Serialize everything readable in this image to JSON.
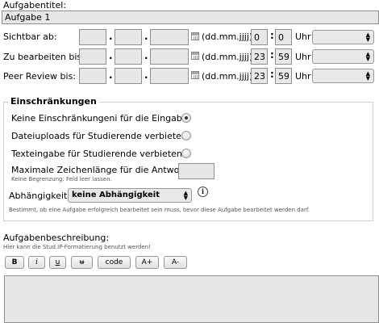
{
  "title": {
    "label": "Aufgabentitel:",
    "value": "Aufgabe 1"
  },
  "date_rows": [
    {
      "label": "Sichtbar ab:",
      "day": "",
      "month": "",
      "year": "",
      "format": "(dd.mm.jjjj)",
      "hour": "0",
      "minute": "0",
      "uhr": "Uhr",
      "select": ""
    },
    {
      "label": "Zu bearbeiten bis:",
      "day": "",
      "month": "",
      "year": "",
      "format": "(dd.mm.jjjj)",
      "hour": "23",
      "minute": "59",
      "uhr": "Uhr",
      "select": ""
    },
    {
      "label": "Peer Review bis:",
      "day": "",
      "month": "",
      "year": "",
      "format": "(dd.mm.jjjj)",
      "hour": "23",
      "minute": "59",
      "uhr": "Uhr",
      "select": ""
    }
  ],
  "restrictions": {
    "legend": "Einschränkungen",
    "options": [
      {
        "label": "Keine Einschränkungeni für die Eingabe:",
        "selected": true
      },
      {
        "label": "Dateiuploads für Studierende verbieten:",
        "selected": false
      },
      {
        "label": "Texteingabe für Studierende verbieten:",
        "selected": false
      }
    ],
    "max_length_label": "Maximale Zeichenlänge für die Antwort:",
    "max_length_value": "",
    "max_length_hint": "Keine Begrenzung: Feld leer lassen.",
    "dependency_label": "Abhängigkeit:",
    "dependency_value": "keine Abhängigkeit",
    "dependency_hint": "Bestimmt, ob eine Aufgabe erfolgreich bearbeitet sein muss, bevor diese Aufgabe bearbeitet werden darf."
  },
  "description": {
    "label": "Aufgabenbeschreibung:",
    "hint": "Hier kann die Stud.IP-Formatierung benutzt werden!",
    "toolbar": [
      "B",
      "i",
      "u",
      "u",
      "code",
      "A+",
      "A-"
    ],
    "text": ""
  }
}
